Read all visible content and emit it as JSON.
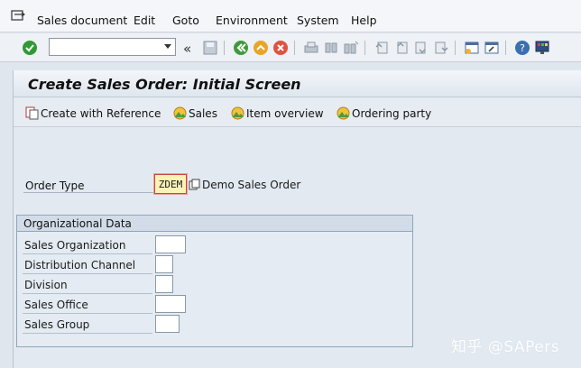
{
  "menu": {
    "items": [
      {
        "label": "Sales document"
      },
      {
        "label": "Edit"
      },
      {
        "label": "Goto"
      },
      {
        "label": "Environment"
      },
      {
        "label": "System"
      },
      {
        "label": "Help"
      }
    ]
  },
  "toolbar": {
    "command_value": "",
    "icons": [
      "enter-icon",
      "back-icon",
      "save-icon",
      "exit-icon",
      "cancel-icon",
      "print-icon",
      "find-icon",
      "find-next-icon",
      "first-page-icon",
      "prev-page-icon",
      "next-page-icon",
      "last-page-icon",
      "new-session-icon",
      "shortcut-icon",
      "help-icon",
      "layout-icon"
    ]
  },
  "page": {
    "title": "Create Sales Order: Initial Screen"
  },
  "app_toolbar": {
    "create_with_reference": "Create with Reference",
    "sales": "Sales",
    "item_overview": "Item overview",
    "ordering_party": "Ordering party"
  },
  "order_type": {
    "label": "Order Type",
    "value": "ZDEM",
    "description": "Demo Sales Order"
  },
  "org_data": {
    "title": "Organizational Data",
    "fields": [
      {
        "label": "Sales Organization",
        "value": ""
      },
      {
        "label": "Distribution Channel",
        "value": ""
      },
      {
        "label": "Division",
        "value": ""
      },
      {
        "label": "Sales Office",
        "value": ""
      },
      {
        "label": "Sales Group",
        "value": ""
      }
    ]
  },
  "watermark": "知乎 @SAPers",
  "colors": {
    "background": "#dfe6ee",
    "required_field_bg": "#fbf3b6",
    "focus_border": "#c8443f",
    "enter_green": "#2e9a35"
  }
}
